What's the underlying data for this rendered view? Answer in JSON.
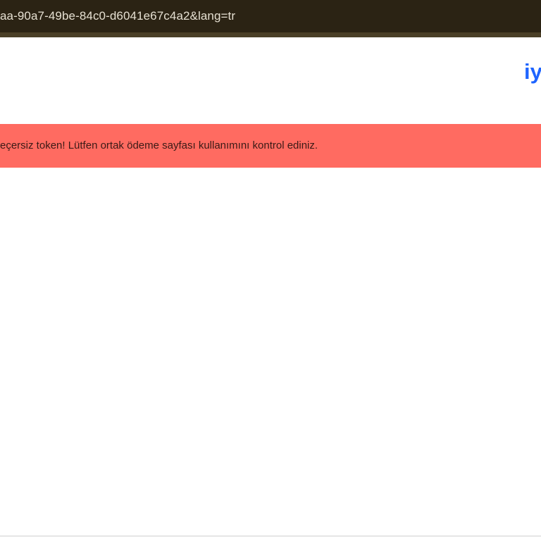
{
  "browser": {
    "url_visible": "aa-90a7-49be-84c0-d6041e67c4a2&lang=tr"
  },
  "header": {
    "logo_text": "iy",
    "logo_color": "#1e64ff"
  },
  "alert": {
    "message": "eçersiz token! Lütfen ortak ödeme sayfası kullanımını kontrol ediniz.",
    "background_color": "#ff6b61"
  }
}
